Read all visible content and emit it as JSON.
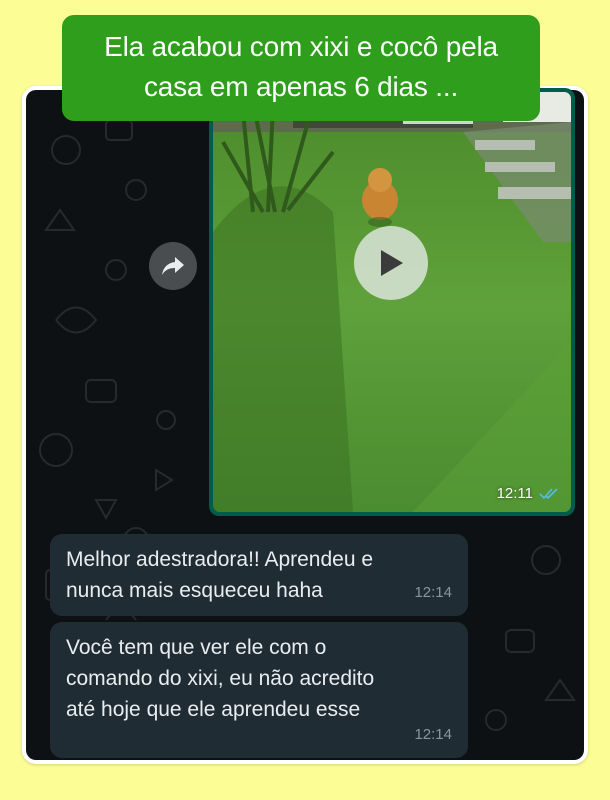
{
  "headline": {
    "text": "Ela acabou com xixi e cocô pela casa em apenas 6 dias ..."
  },
  "chat": {
    "video_message": {
      "time": "12:11",
      "status": "read",
      "icons": {
        "play": "play-icon",
        "forward": "forward-icon",
        "ticks": "double-check-icon"
      }
    },
    "messages": [
      {
        "text": "Melhor adestradora!! Aprendeu e nunca mais esqueceu haha",
        "time": "12:14"
      },
      {
        "text": "Você tem que ver ele com o comando do xixi, eu não acredito até hoje que ele aprendeu esse",
        "time": "12:14"
      }
    ]
  },
  "colors": {
    "page_background": "#fdfd96",
    "headline_background": "#2e9e1c",
    "chat_background": "#0d1114",
    "outgoing_bubble": "#005c4b",
    "incoming_bubble": "#202c33",
    "read_ticks": "#53bdeb"
  }
}
